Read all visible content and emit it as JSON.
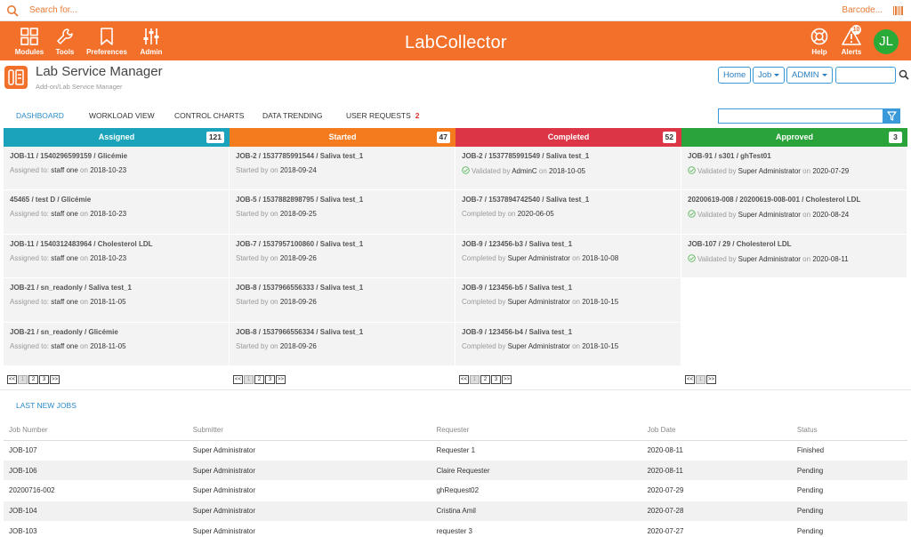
{
  "search": {
    "placeholder": "Search for...",
    "barcode_label": "Barcode..."
  },
  "nav": {
    "items": [
      "Modules",
      "Tools",
      "Preferences",
      "Admin"
    ],
    "help": "Help",
    "alerts": "Alerts",
    "alerts_count": "10",
    "avatar_initials": "JL"
  },
  "logo": {
    "text": "LabCollector"
  },
  "app": {
    "name": "Lab Service Manager",
    "path": "Add-on/Lab Service Manager",
    "home": "Home",
    "job": "Job",
    "admin": "ADMIN"
  },
  "tabs": [
    {
      "label": "DASHBOARD"
    },
    {
      "label": "WORKLOAD VIEW"
    },
    {
      "label": "CONTROL CHARTS"
    },
    {
      "label": "DATA TRENDING"
    },
    {
      "label": "USER REQUESTS",
      "count": "2"
    }
  ],
  "columns": [
    {
      "title": "Assigned",
      "count": "121",
      "color": "#1aa3bb",
      "cards": [
        {
          "title": "JOB-11 / 1540296599159 / Glicémie",
          "verb": "Assigned to:",
          "who": "staff one",
          "on": "on",
          "date": "2018-10-23"
        },
        {
          "title": "45465 / test D / Glicémie",
          "verb": "Assigned to:",
          "who": "staff one",
          "on": "on",
          "date": "2018-10-23"
        },
        {
          "title": "JOB-11 / 1540312483964 / Cholesterol LDL",
          "verb": "Assigned to:",
          "who": "staff one",
          "on": "on",
          "date": "2018-10-23"
        },
        {
          "title": "JOB-21 / sn_readonly / Saliva test_1",
          "verb": "Assigned to:",
          "who": "staff one",
          "on": "on",
          "date": "2018-11-05"
        },
        {
          "title": "JOB-21 / sn_readonly / Glicémie",
          "verb": "Assigned to:",
          "who": "staff one",
          "on": "on",
          "date": "2018-11-05"
        }
      ],
      "pager": [
        "<<",
        "1",
        "2",
        "3",
        ">>"
      ]
    },
    {
      "title": "Started",
      "count": "47",
      "color": "#f47c1f",
      "cards": [
        {
          "title": "JOB-2 / 1537785991544 / Saliva test_1",
          "verb": "Started by",
          "who": "",
          "on": "on",
          "date": "2018-09-24"
        },
        {
          "title": "JOB-5 / 1537882898795 / Saliva test_1",
          "verb": "Started by",
          "who": "",
          "on": "on",
          "date": "2018-09-25"
        },
        {
          "title": "JOB-7 / 1537957100860 / Saliva test_1",
          "verb": "Started by",
          "who": "",
          "on": "on",
          "date": "2018-09-26"
        },
        {
          "title": "JOB-8 / 1537966556333 / Saliva test_1",
          "verb": "Started by",
          "who": "",
          "on": "on",
          "date": "2018-09-26"
        },
        {
          "title": "JOB-8 / 1537966556334 / Saliva test_1",
          "verb": "Started by",
          "who": "",
          "on": "on",
          "date": "2018-09-26"
        }
      ],
      "pager": [
        "<<",
        "1",
        "2",
        "3",
        ">>"
      ]
    },
    {
      "title": "Completed",
      "count": "52",
      "color": "#dc3545",
      "cards": [
        {
          "title": "JOB-2 / 1537785991549 / Saliva test_1",
          "verb": "Validated by",
          "who": "AdminC",
          "on": "on",
          "date": "2018-10-05",
          "ok": true
        },
        {
          "title": "JOB-7 / 1537894742540 / Saliva test_1",
          "verb": "Completed by",
          "who": "",
          "on": "on",
          "date": "2020-06-05"
        },
        {
          "title": "JOB-9 / 123456-b3 / Saliva test_1",
          "verb": "Completed by",
          "who": "Super Administrator",
          "on": "on",
          "date": "2018-10-08"
        },
        {
          "title": "JOB-9 / 123456-b5 / Saliva test_1",
          "verb": "Completed by",
          "who": "Super Administrator",
          "on": "on",
          "date": "2018-10-15"
        },
        {
          "title": "JOB-9 / 123456-b4 / Saliva test_1",
          "verb": "Completed by",
          "who": "Super Administrator",
          "on": "on",
          "date": "2018-10-15"
        }
      ],
      "pager": [
        "<<",
        "1",
        "2",
        "3",
        ">>"
      ]
    },
    {
      "title": "Approved",
      "count": "3",
      "color": "#2aa33a",
      "cards": [
        {
          "title": "JOB-91 / s301 / ghTest01",
          "verb": "Validated by",
          "who": "Super Administrator",
          "on": "on",
          "date": "2020-07-29",
          "ok": true
        },
        {
          "title": "20200619-008 / 20200619-008-001 / Cholesterol LDL",
          "verb": "Validated by",
          "who": "Super Administrator",
          "on": "on",
          "date": "2020-08-24",
          "ok": true
        },
        {
          "title": "JOB-107 / 29 / Cholesterol LDL",
          "verb": "Validated by",
          "who": "Super Administrator",
          "on": "on",
          "date": "2020-08-11",
          "ok": true
        }
      ],
      "pager": [
        "<<",
        "1",
        ">>"
      ]
    }
  ],
  "last_jobs": {
    "title": "LAST NEW JOBS",
    "headers": [
      "Job Number",
      "Submitter",
      "Requester",
      "Job Date",
      "Status"
    ],
    "rows": [
      [
        "JOB-107",
        "Super Administrator",
        "Requester 1",
        "2020-08-11",
        "Finished"
      ],
      [
        "JOB-106",
        "Super Administrator",
        "Claire Requester",
        "2020-08-11",
        "Pending"
      ],
      [
        "20200716-002",
        "Super Administrator",
        "ghRequest02",
        "2020-07-29",
        "Pending"
      ],
      [
        "JOB-104",
        "Super Administrator",
        "Cristina Amil",
        "2020-07-28",
        "Pending"
      ],
      [
        "JOB-103",
        "Super Administrator",
        "requester 3",
        "2020-07-27",
        "Pending"
      ]
    ]
  }
}
